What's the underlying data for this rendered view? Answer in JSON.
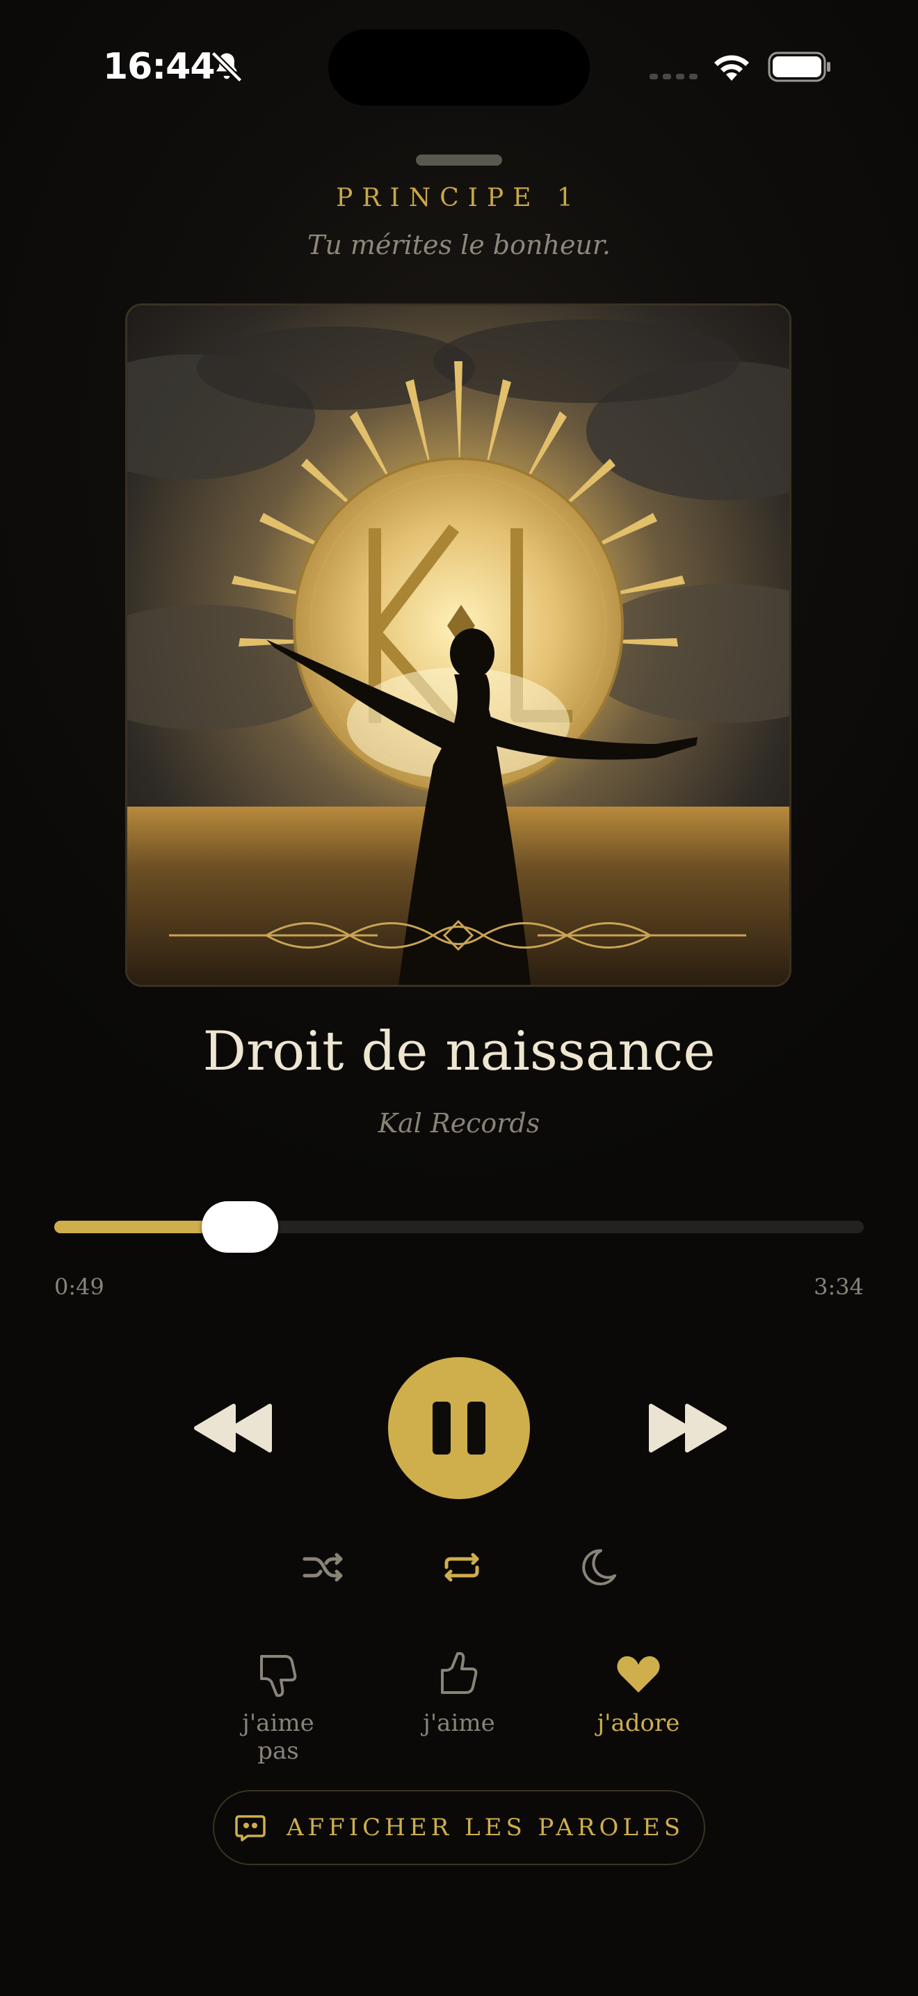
{
  "status_bar": {
    "time": "16:44"
  },
  "sheet": {
    "principle_label": "PRINCIPE 1",
    "principle_text": "Tu mérites le bonheur."
  },
  "track": {
    "title": "Droit de naissance",
    "artist": "Kal Records",
    "elapsed": "0:49",
    "duration": "3:34",
    "progress_fraction": 0.229
  },
  "reactions": {
    "dislike_label": "j'aime pas",
    "like_label": "j'aime",
    "love_label": "j'adore"
  },
  "lyrics_button": {
    "label": "AFFICHER LES PAROLES"
  },
  "colors": {
    "accent": "#cfae4c",
    "background": "#0b0a09",
    "text_primary": "#efe6d1",
    "text_muted": "#8a8376"
  },
  "icons": [
    "bell-slash-icon",
    "wifi-icon",
    "battery-icon",
    "rewind-icon",
    "pause-icon",
    "fast-forward-icon",
    "shuffle-icon",
    "repeat-icon",
    "moon-icon",
    "thumbs-down-icon",
    "thumbs-up-icon",
    "heart-icon",
    "quote-bubble-icon"
  ]
}
